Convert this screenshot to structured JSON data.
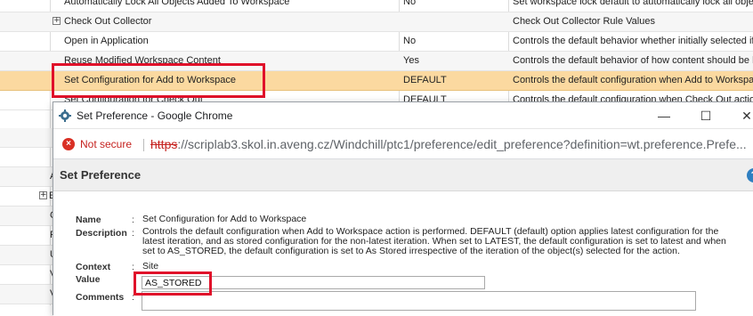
{
  "table": {
    "rows": [
      {
        "name": "Automatically Lock All Objects Added To Workspace",
        "value": "No",
        "description": "Set workspace lock default to automatically lock all obje"
      },
      {
        "name": "Check Out Collector",
        "value": "",
        "description": "Check Out Collector Rule Values"
      },
      {
        "name": "Open in Application",
        "value": "No",
        "description": "Controls the default behavior whether initially selected if"
      },
      {
        "name": "Reuse Modified Workspace Content",
        "value": "Yes",
        "description": "Controls the default behavior of how content should be l"
      },
      {
        "name": "Set Configuration for Add to Workspace",
        "value": "DEFAULT",
        "description": "Controls the default configuration when Add to Workspace"
      },
      {
        "name": "Set Configuration for Check Out",
        "value": "DEFAULT",
        "description": "Controls the default configuration when Check Out action"
      }
    ],
    "expander_glyph": "+",
    "left_stubs": [
      "A",
      "E",
      "C",
      "R",
      "U",
      "V",
      "V"
    ]
  },
  "popup": {
    "window_title": "Set Preference - Google Chrome",
    "security_label": "Not secure",
    "security_icon": "warning-circle-icon",
    "url_scheme": "https",
    "url_rest": "://scriplab3.skol.in.aveng.cz/Windchill/ptc1/preference/edit_preference?definition=wt.preference.Prefe...",
    "page_title": "Set Preference",
    "help_icon": "help-icon",
    "form": {
      "name_label": "Name",
      "name_value": "Set Configuration for Add to Workspace",
      "description_label": "Description",
      "description_value": "Controls the default configuration when Add to Workspace action is performed. DEFAULT (default) option applies latest configuration for the latest iteration, and as stored configuration for the non-latest iteration. When set to LATEST, the default configuration is set to latest and when set to AS_STORED, the default configuration is set to As Stored irrespective of the iteration of the object(s) selected for the action.",
      "context_label": "Context",
      "context_value": "Site",
      "value_label": "Value",
      "value_input": "AS_STORED",
      "comments_label": "Comments",
      "colon": ":"
    }
  },
  "colors": {
    "selected_row": "#fbd9a0",
    "highlight_box": "#e0102a",
    "not_secure": "#c5221f",
    "header_bg": "#efefef"
  }
}
